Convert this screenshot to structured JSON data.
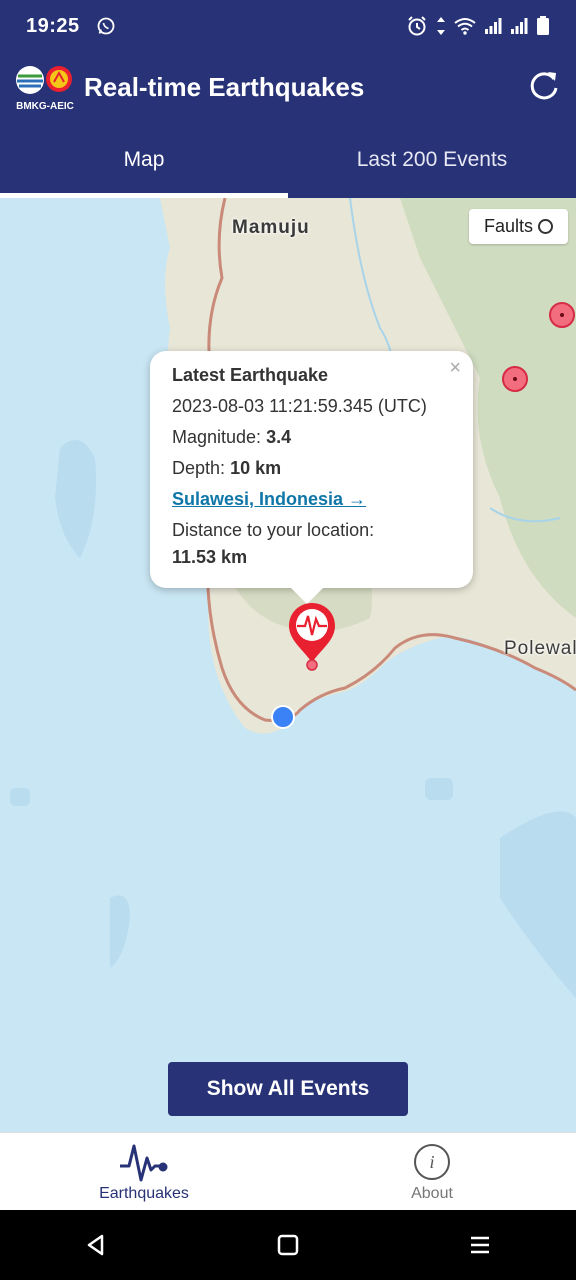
{
  "status_bar": {
    "time": "19:25",
    "icons": [
      "whatsapp-icon",
      "alarm-icon",
      "data-arrows-icon",
      "wifi-icon",
      "signal-icon",
      "signal-icon",
      "battery-icon"
    ]
  },
  "app_bar": {
    "logo_text": "BMKG-AEIC",
    "title": "Real-time Earthquakes",
    "refresh_icon": "refresh-icon"
  },
  "tabs": [
    {
      "label": "Map",
      "active": true
    },
    {
      "label": "Last 200 Events",
      "active": false
    }
  ],
  "map": {
    "labels": [
      "Mamuju",
      "Polewali"
    ],
    "faults_toggle": {
      "label": "Faults",
      "checked": false
    },
    "popup": {
      "heading": "Latest Earthquake",
      "datetime": "2023-08-03 11:21:59.345 (UTC)",
      "magnitude_label": "Magnitude:",
      "magnitude_value": "3.4",
      "depth_label": "Depth:",
      "depth_value": "10 km",
      "location_link": "Sulawesi, Indonesia →",
      "distance_label": "Distance to your location:",
      "distance_value": "11.53 km",
      "close_symbol": "×"
    },
    "show_all_button": "Show All Events"
  },
  "bottom_nav": [
    {
      "label": "Earthquakes",
      "icon": "seismograph-icon",
      "active": true
    },
    {
      "label": "About",
      "icon": "info-icon",
      "active": false
    }
  ],
  "colors": {
    "primary": "#283277",
    "quake_marker": "#e8202f",
    "user_location": "#3b82f6",
    "link": "#0f76a8"
  }
}
